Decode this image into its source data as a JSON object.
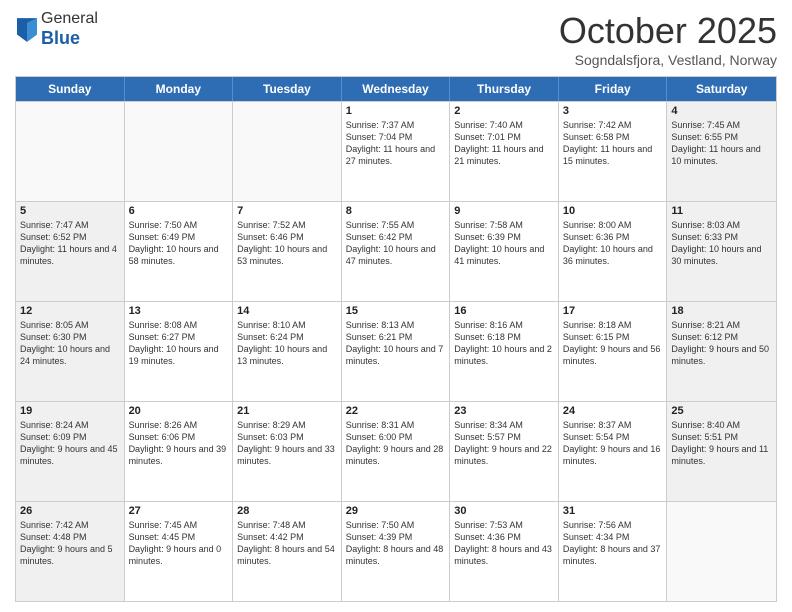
{
  "logo": {
    "general": "General",
    "blue": "Blue"
  },
  "header": {
    "title": "October 2025",
    "subtitle": "Sogndalsfjora, Vestland, Norway"
  },
  "days_of_week": [
    "Sunday",
    "Monday",
    "Tuesday",
    "Wednesday",
    "Thursday",
    "Friday",
    "Saturday"
  ],
  "weeks": [
    [
      {
        "day": "",
        "empty": true
      },
      {
        "day": "",
        "empty": true
      },
      {
        "day": "",
        "empty": true
      },
      {
        "day": "1",
        "sunrise": "7:37 AM",
        "sunset": "7:04 PM",
        "daylight": "11 hours and 27 minutes."
      },
      {
        "day": "2",
        "sunrise": "7:40 AM",
        "sunset": "7:01 PM",
        "daylight": "11 hours and 21 minutes."
      },
      {
        "day": "3",
        "sunrise": "7:42 AM",
        "sunset": "6:58 PM",
        "daylight": "11 hours and 15 minutes."
      },
      {
        "day": "4",
        "sunrise": "7:45 AM",
        "sunset": "6:55 PM",
        "daylight": "11 hours and 10 minutes."
      }
    ],
    [
      {
        "day": "5",
        "sunrise": "7:47 AM",
        "sunset": "6:52 PM",
        "daylight": "11 hours and 4 minutes."
      },
      {
        "day": "6",
        "sunrise": "7:50 AM",
        "sunset": "6:49 PM",
        "daylight": "10 hours and 58 minutes."
      },
      {
        "day": "7",
        "sunrise": "7:52 AM",
        "sunset": "6:46 PM",
        "daylight": "10 hours and 53 minutes."
      },
      {
        "day": "8",
        "sunrise": "7:55 AM",
        "sunset": "6:42 PM",
        "daylight": "10 hours and 47 minutes."
      },
      {
        "day": "9",
        "sunrise": "7:58 AM",
        "sunset": "6:39 PM",
        "daylight": "10 hours and 41 minutes."
      },
      {
        "day": "10",
        "sunrise": "8:00 AM",
        "sunset": "6:36 PM",
        "daylight": "10 hours and 36 minutes."
      },
      {
        "day": "11",
        "sunrise": "8:03 AM",
        "sunset": "6:33 PM",
        "daylight": "10 hours and 30 minutes."
      }
    ],
    [
      {
        "day": "12",
        "sunrise": "8:05 AM",
        "sunset": "6:30 PM",
        "daylight": "10 hours and 24 minutes."
      },
      {
        "day": "13",
        "sunrise": "8:08 AM",
        "sunset": "6:27 PM",
        "daylight": "10 hours and 19 minutes."
      },
      {
        "day": "14",
        "sunrise": "8:10 AM",
        "sunset": "6:24 PM",
        "daylight": "10 hours and 13 minutes."
      },
      {
        "day": "15",
        "sunrise": "8:13 AM",
        "sunset": "6:21 PM",
        "daylight": "10 hours and 7 minutes."
      },
      {
        "day": "16",
        "sunrise": "8:16 AM",
        "sunset": "6:18 PM",
        "daylight": "10 hours and 2 minutes."
      },
      {
        "day": "17",
        "sunrise": "8:18 AM",
        "sunset": "6:15 PM",
        "daylight": "9 hours and 56 minutes."
      },
      {
        "day": "18",
        "sunrise": "8:21 AM",
        "sunset": "6:12 PM",
        "daylight": "9 hours and 50 minutes."
      }
    ],
    [
      {
        "day": "19",
        "sunrise": "8:24 AM",
        "sunset": "6:09 PM",
        "daylight": "9 hours and 45 minutes."
      },
      {
        "day": "20",
        "sunrise": "8:26 AM",
        "sunset": "6:06 PM",
        "daylight": "9 hours and 39 minutes."
      },
      {
        "day": "21",
        "sunrise": "8:29 AM",
        "sunset": "6:03 PM",
        "daylight": "9 hours and 33 minutes."
      },
      {
        "day": "22",
        "sunrise": "8:31 AM",
        "sunset": "6:00 PM",
        "daylight": "9 hours and 28 minutes."
      },
      {
        "day": "23",
        "sunrise": "8:34 AM",
        "sunset": "5:57 PM",
        "daylight": "9 hours and 22 minutes."
      },
      {
        "day": "24",
        "sunrise": "8:37 AM",
        "sunset": "5:54 PM",
        "daylight": "9 hours and 16 minutes."
      },
      {
        "day": "25",
        "sunrise": "8:40 AM",
        "sunset": "5:51 PM",
        "daylight": "9 hours and 11 minutes."
      }
    ],
    [
      {
        "day": "26",
        "sunrise": "7:42 AM",
        "sunset": "4:48 PM",
        "daylight": "9 hours and 5 minutes."
      },
      {
        "day": "27",
        "sunrise": "7:45 AM",
        "sunset": "4:45 PM",
        "daylight": "9 hours and 0 minutes."
      },
      {
        "day": "28",
        "sunrise": "7:48 AM",
        "sunset": "4:42 PM",
        "daylight": "8 hours and 54 minutes."
      },
      {
        "day": "29",
        "sunrise": "7:50 AM",
        "sunset": "4:39 PM",
        "daylight": "8 hours and 48 minutes."
      },
      {
        "day": "30",
        "sunrise": "7:53 AM",
        "sunset": "4:36 PM",
        "daylight": "8 hours and 43 minutes."
      },
      {
        "day": "31",
        "sunrise": "7:56 AM",
        "sunset": "4:34 PM",
        "daylight": "8 hours and 37 minutes."
      },
      {
        "day": "",
        "empty": true
      }
    ]
  ],
  "labels": {
    "sunrise": "Sunrise:",
    "sunset": "Sunset:",
    "daylight": "Daylight:"
  }
}
